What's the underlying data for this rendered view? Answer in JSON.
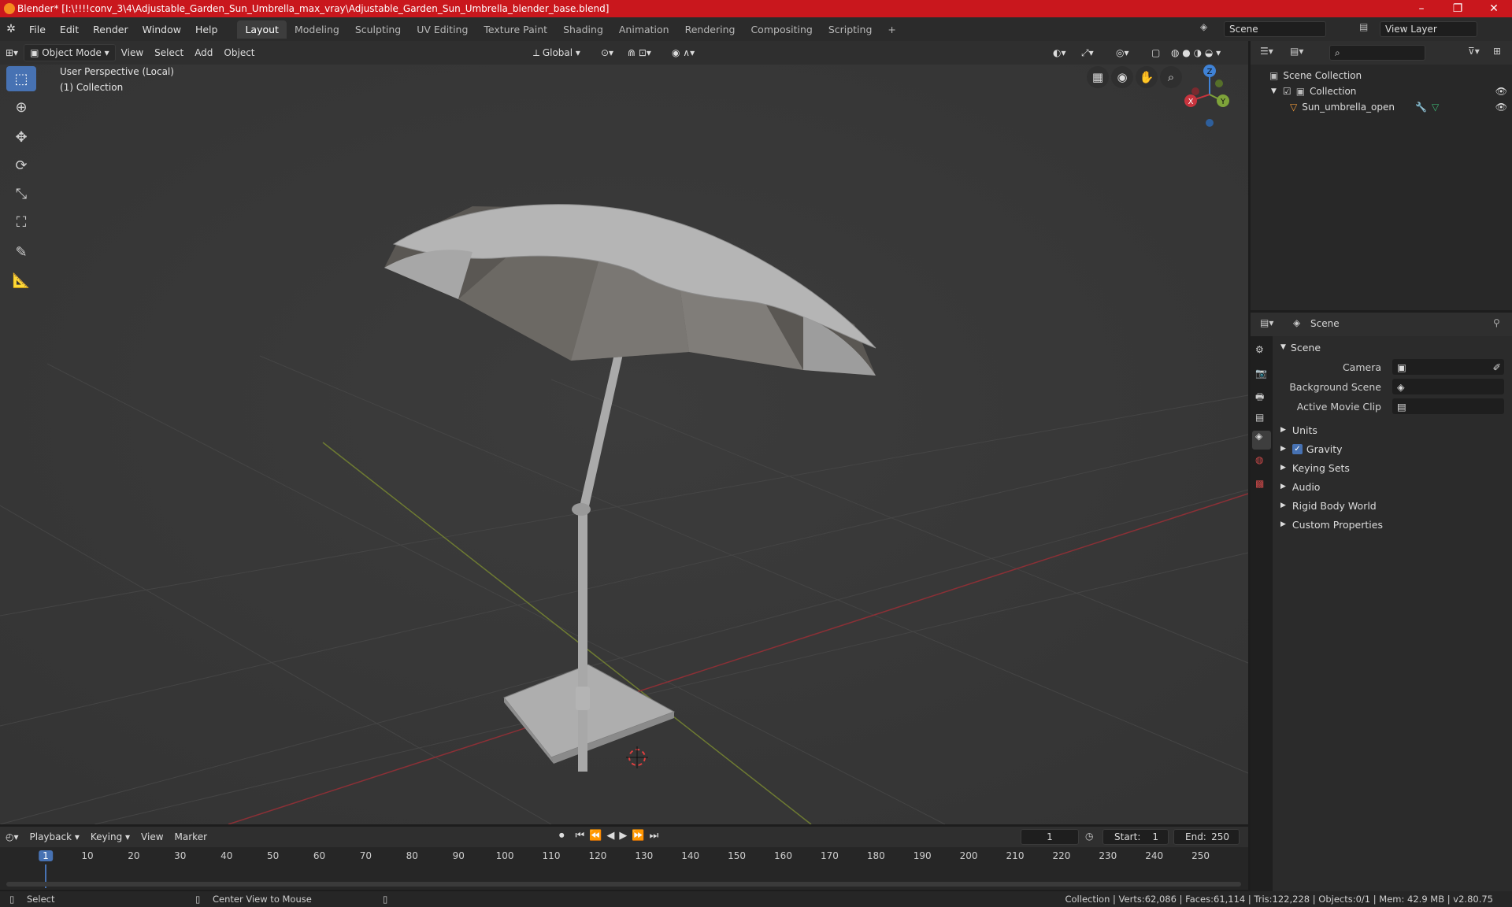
{
  "window": {
    "title": "Blender* [I:\\!!!!conv_3\\4\\Adjustable_Garden_Sun_Umbrella_max_vray\\Adjustable_Garden_Sun_Umbrella_blender_base.blend]",
    "minimize": "–",
    "maximize": "❐",
    "close": "✕"
  },
  "menus": [
    "File",
    "Edit",
    "Render",
    "Window",
    "Help"
  ],
  "workspaces": [
    {
      "label": "Layout",
      "active": true
    },
    {
      "label": "Modeling"
    },
    {
      "label": "Sculpting"
    },
    {
      "label": "UV Editing"
    },
    {
      "label": "Texture Paint"
    },
    {
      "label": "Shading"
    },
    {
      "label": "Animation"
    },
    {
      "label": "Rendering"
    },
    {
      "label": "Compositing"
    },
    {
      "label": "Scripting"
    }
  ],
  "add_workspace": "+",
  "scene_selector": "Scene",
  "view_layer_selector": "View Layer",
  "viewport_header": {
    "mode": "Object Mode",
    "menus": [
      "View",
      "Select",
      "Add",
      "Object"
    ],
    "orientation": "Global"
  },
  "viewport": {
    "perspective_label": "User Perspective (Local)",
    "collection_label": "(1) Collection",
    "gizmo": {
      "x": "X",
      "y": "Y",
      "z": "Z"
    }
  },
  "outliner": {
    "scene_collection": "Scene Collection",
    "collection": "Collection",
    "object": "Sun_umbrella_open"
  },
  "properties": {
    "header": "Scene",
    "panel": "Scene",
    "camera_label": "Camera",
    "background_scene_label": "Background Scene",
    "active_movie_clip_label": "Active Movie Clip",
    "sections": [
      "Units",
      "Gravity",
      "Keying Sets",
      "Audio",
      "Rigid Body World",
      "Custom Properties"
    ]
  },
  "timeline": {
    "menus": [
      "Playback",
      "Keying",
      "View",
      "Marker"
    ],
    "current_frame": "1",
    "start_label": "Start:",
    "start": "1",
    "end_label": "End:",
    "end": "250",
    "ticks": [
      "1",
      "10",
      "20",
      "30",
      "40",
      "50",
      "60",
      "70",
      "80",
      "90",
      "100",
      "110",
      "120",
      "130",
      "140",
      "150",
      "160",
      "170",
      "180",
      "190",
      "200",
      "210",
      "220",
      "230",
      "240",
      "250"
    ]
  },
  "status": {
    "left": "Select",
    "middle": "Center View to Mouse",
    "right": "Collection | Verts:62,086 | Faces:61,114 | Tris:122,228 | Objects:0/1 | Mem: 42.9 MB | v2.80.75"
  },
  "colors": {
    "titlebar": "#c9171d",
    "accent": "#4772b3",
    "x_axis": "#c8343e",
    "y_axis": "#7ea33a",
    "z_axis": "#3f82d6"
  }
}
